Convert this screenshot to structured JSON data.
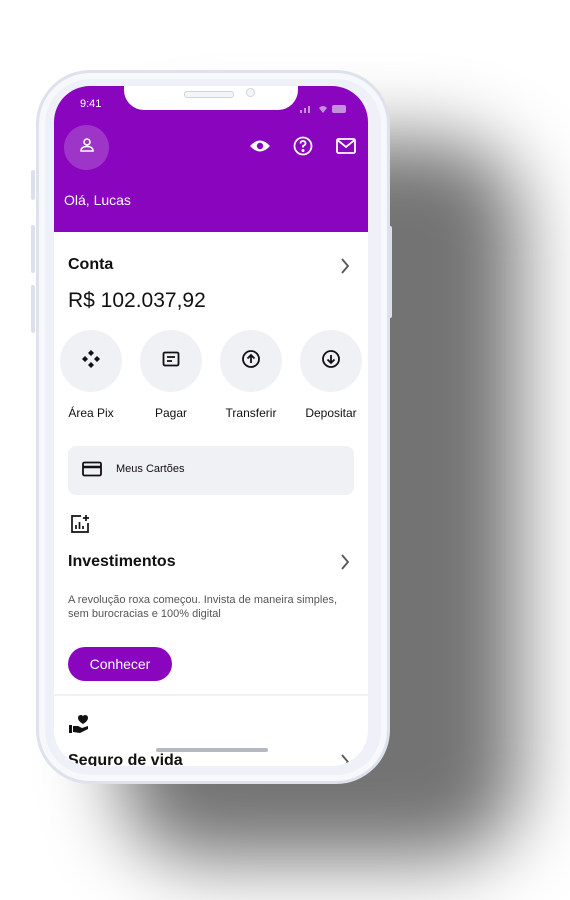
{
  "status_bar": {
    "time": "9:41"
  },
  "header": {
    "greeting": "Olá, Lucas"
  },
  "account": {
    "title": "Conta",
    "balance": "R$ 102.037,92",
    "actions": [
      {
        "label": "Área Pix",
        "icon": "pix-icon"
      },
      {
        "label": "Pagar",
        "icon": "barcode-icon"
      },
      {
        "label": "Transferir",
        "icon": "arrow-up-circle-icon"
      },
      {
        "label": "Depositar",
        "icon": "arrow-down-circle-icon"
      }
    ],
    "cards_label": "Meus Cartões"
  },
  "investments": {
    "title": "Investimentos",
    "description": "A revolução roxa começou. Invista de maneira simples, sem burocracias e 100% digital",
    "cta": "Conhecer"
  },
  "insurance": {
    "title": "Seguro de vida"
  },
  "colors": {
    "brand": "#8a05be",
    "surface": "#f0f1f5"
  }
}
